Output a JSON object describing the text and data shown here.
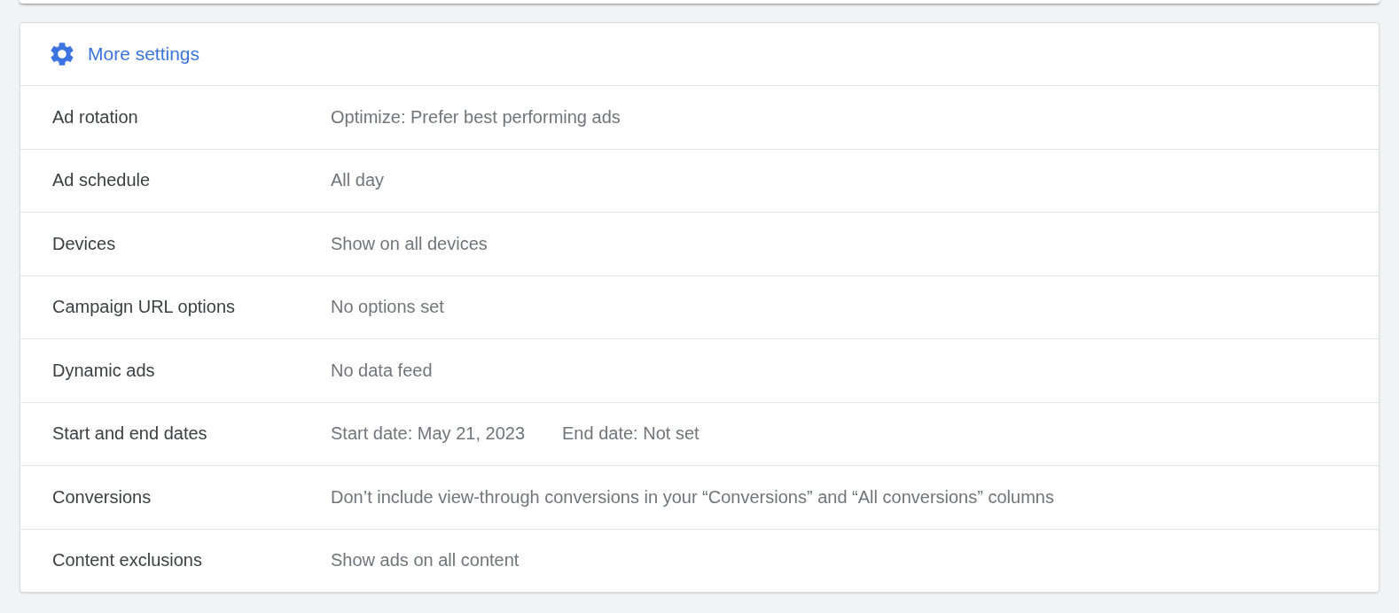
{
  "header": {
    "title": "More settings"
  },
  "settings": [
    {
      "label": "Ad rotation",
      "values": [
        "Optimize: Prefer best performing ads"
      ]
    },
    {
      "label": "Ad schedule",
      "values": [
        "All day"
      ]
    },
    {
      "label": "Devices",
      "values": [
        "Show on all devices"
      ]
    },
    {
      "label": "Campaign URL options",
      "values": [
        "No options set"
      ]
    },
    {
      "label": "Dynamic ads",
      "values": [
        "No data feed"
      ]
    },
    {
      "label": "Start and end dates",
      "values": [
        "Start date: May 21, 2023",
        "End date: Not set"
      ]
    },
    {
      "label": "Conversions",
      "values": [
        "Don’t include view-through conversions in your “Conversions” and “All conversions” columns"
      ]
    },
    {
      "label": "Content exclusions",
      "values": [
        "Show ads on all content"
      ]
    }
  ]
}
